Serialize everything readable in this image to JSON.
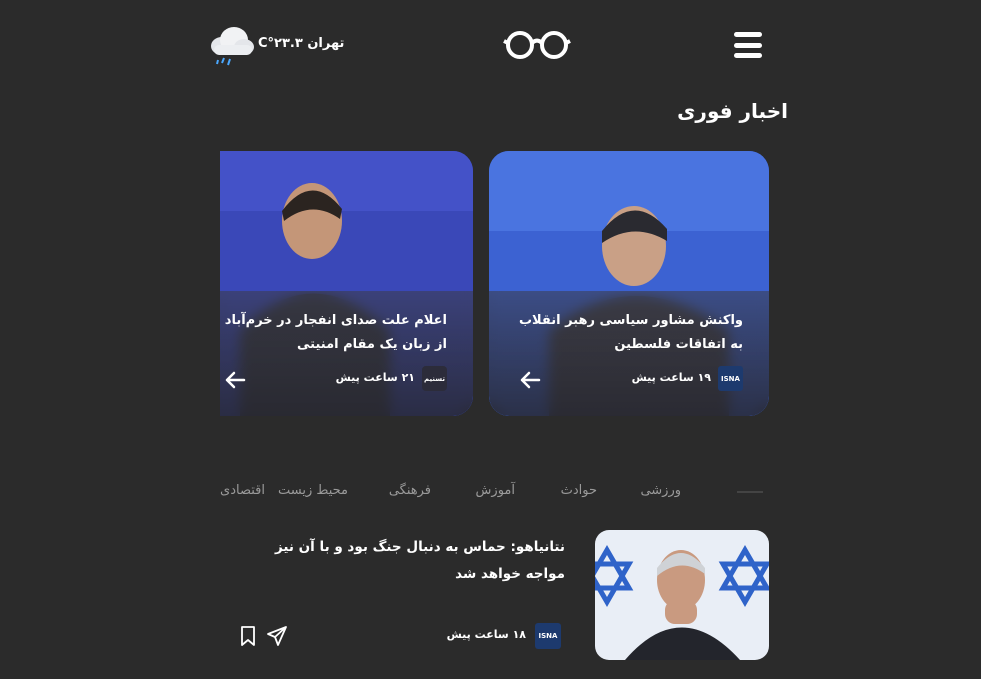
{
  "header": {
    "menu_icon": "hamburger-menu-icon",
    "logo_icon": "glasses-logo-icon",
    "weather": {
      "icon": "cloud-rain-icon",
      "text": "تهران ۲۳.۳°C"
    }
  },
  "breaking": {
    "title": "اخبار فوری",
    "cards": [
      {
        "title": "واکنش مشاور سیاسی رهبر انقلاب به اتفاقات فلسطین",
        "source": "ISNA",
        "time": "۱۹ ساعت پیش",
        "arrow_icon": "arrow-left-icon"
      },
      {
        "title": "اعلام علت صدای انفجار در خرم‌آباد از زبان یک مقام امنیتی",
        "source": "تسنیم",
        "time": "۲۱ ساعت پیش",
        "arrow_icon": "arrow-left-icon"
      }
    ]
  },
  "tabs": [
    "ورزشی",
    "حوادث",
    "آموزش",
    "فرهنگی",
    "محیط زیست",
    "اقتصادی"
  ],
  "news": [
    {
      "title": "نتانیاهو: حماس به دنبال جنگ بود و با آن نیز مواجه خواهد شد",
      "source": "ISNA",
      "time": "۱۸ ساعت پیش",
      "share_icon": "send-icon",
      "bookmark_icon": "bookmark-icon"
    }
  ],
  "colors": {
    "background": "#2b2b2b",
    "tab_text": "#9a9a9a",
    "isna_blue": "#1d3a6e",
    "card_blue": "#2a4aa0"
  }
}
